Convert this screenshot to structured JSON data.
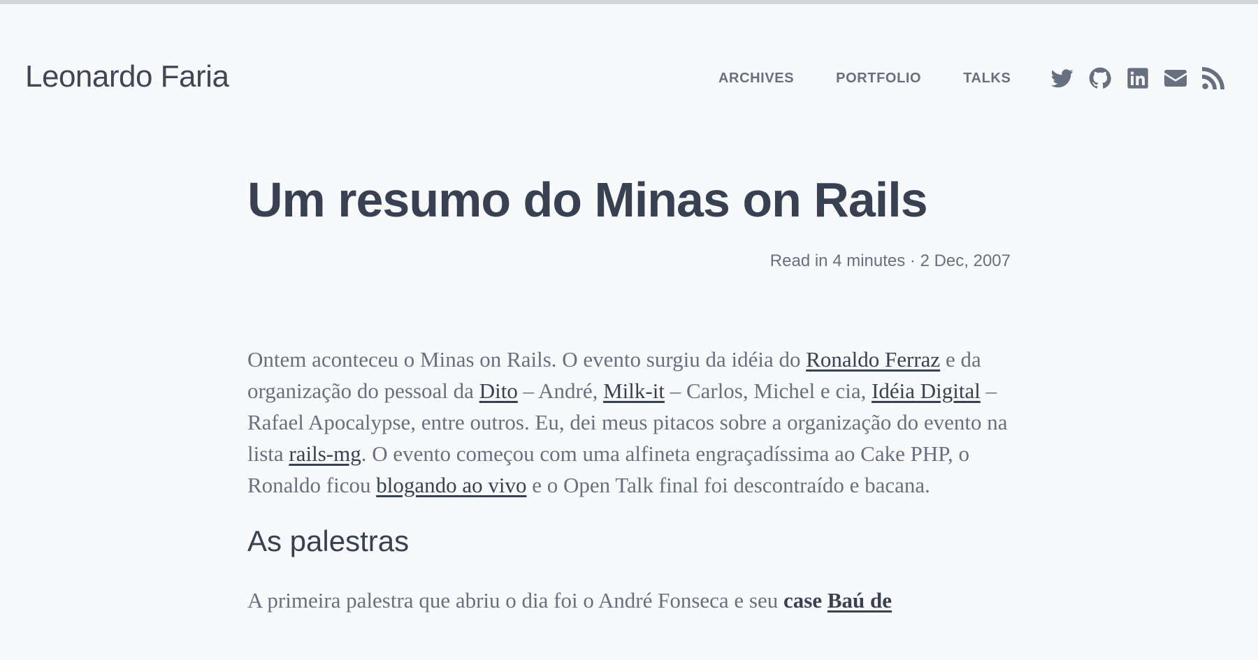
{
  "site": {
    "title": "Leonardo Faria"
  },
  "nav": {
    "items": [
      {
        "label": "ARCHIVES"
      },
      {
        "label": "PORTFOLIO"
      },
      {
        "label": "TALKS"
      }
    ]
  },
  "social": {
    "icons": [
      "twitter-icon",
      "github-icon",
      "linkedin-icon",
      "email-icon",
      "rss-icon"
    ]
  },
  "post": {
    "title": "Um resumo do Minas on Rails",
    "meta": "Read in 4 minutes · 2 Dec, 2007",
    "p1": {
      "t1": "Ontem aconteceu o Minas on Rails. O evento surgiu da idéia do ",
      "link1": "Ronaldo Ferraz",
      "t2": " e da organização do pessoal da ",
      "link2": "Dito",
      "t3": " – André, ",
      "link3": "Milk-it",
      "t4": " – Carlos, Michel e cia, ",
      "link4": "Idéia Digital",
      "t5": " – Rafael Apocalypse, entre outros. Eu, dei meus pitacos sobre a organização do evento na lista ",
      "link5": "rails-mg",
      "t6": ". O evento começou com uma alfineta engraçadíssima ao Cake PHP, o Ronaldo ficou ",
      "link6": "blogando ao vivo",
      "t7": " e o Open Talk final foi descontraído e bacana."
    },
    "heading1": "As palestras",
    "p2": {
      "t1": "A primeira palestra que abriu o dia foi o André Fonseca e seu ",
      "strong1": "case",
      "t2": " ",
      "link1": "Baú de"
    }
  },
  "colors": {
    "background": "#f8f9fb",
    "text_primary": "#374151",
    "text_muted": "#677080",
    "top_bar": "#d4d6dc"
  }
}
